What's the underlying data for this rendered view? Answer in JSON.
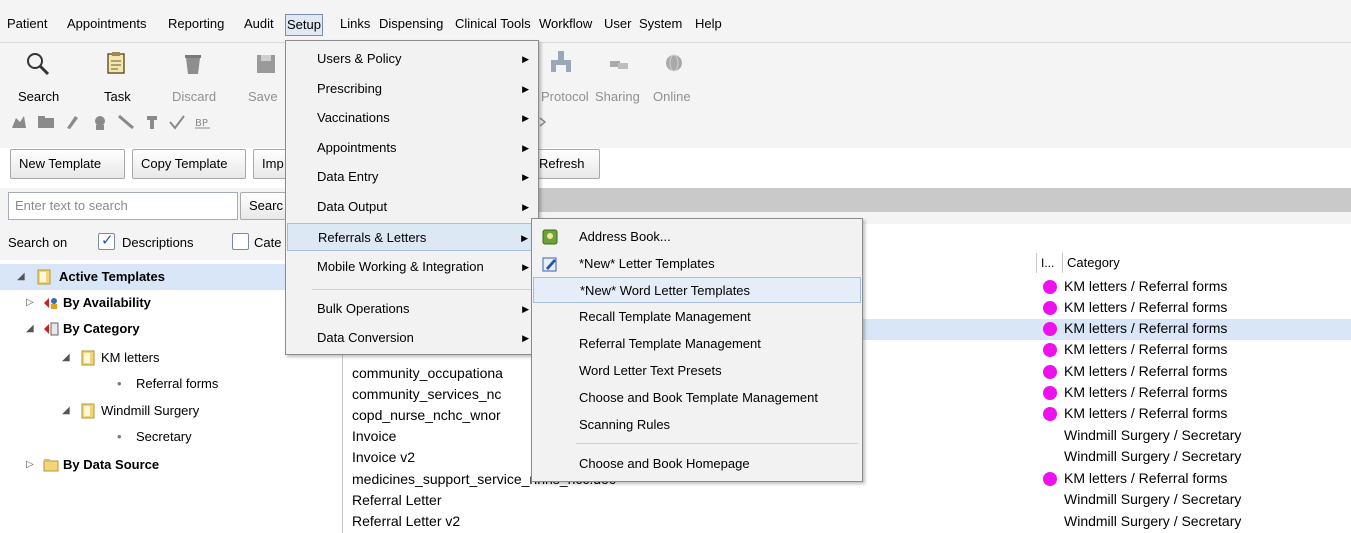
{
  "menubar": [
    "Patient",
    "Appointments",
    "Reporting",
    "Audit",
    "Setup",
    "Links",
    "Dispensing",
    "Clinical Tools",
    "Workflow",
    "User",
    "System",
    "Help"
  ],
  "toolbar": {
    "search": "Search",
    "task": "Task",
    "discard": "Discard",
    "save": "Save",
    "protocol": "Protocol",
    "sharing": "Sharing",
    "online": "Online"
  },
  "buttons": {
    "new_template": "New Template",
    "copy_template": "Copy Template",
    "import": "Imp",
    "refresh": "Refresh"
  },
  "search": {
    "placeholder": "Enter text to search",
    "button": "Searc",
    "search_on": "Search on",
    "descriptions": "Descriptions",
    "categories": "Cate"
  },
  "tree": {
    "active_templates": "Active Templates",
    "by_availability": "By Availability",
    "by_category": "By Category",
    "km_letters": "KM letters",
    "referral_forms": "Referral forms",
    "windmill_surgery": "Windmill Surgery",
    "secretary": "Secretary",
    "by_data_source": "By Data Source"
  },
  "table": {
    "col_i": "I...",
    "col_category": "Category",
    "names": [
      "community_occupationa",
      "community_services_nc",
      "copd_nurse_nchc_wnor",
      "Invoice",
      "Invoice v2",
      "medicines_support_service_nhns_ncc.doc",
      "Referral Letter",
      "Referral Letter v2"
    ],
    "categories": [
      "KM letters / Referral forms",
      "KM letters / Referral forms",
      "KM letters / Referral forms",
      "KM letters / Referral forms",
      "KM letters / Referral forms",
      "KM letters / Referral forms",
      "KM letters / Referral forms",
      "Windmill Surgery / Secretary",
      "Windmill Surgery / Secretary",
      "KM letters / Referral forms",
      "Windmill Surgery / Secretary",
      "Windmill Surgery / Secretary"
    ]
  },
  "setup_menu": {
    "items": [
      "Users & Policy",
      "Prescribing",
      "Vaccinations",
      "Appointments",
      "Data Entry",
      "Data Output",
      "Referrals & Letters",
      "Mobile Working & Integration",
      "Bulk Operations",
      "Data Conversion"
    ]
  },
  "submenu": {
    "items": [
      "Address Book...",
      "*New* Letter Templates",
      "*New* Word Letter Templates",
      "Recall Template Management",
      "Referral Template Management",
      "Word Letter Text Presets",
      "Choose and Book Template Management",
      "Scanning Rules",
      "Choose and Book Homepage"
    ]
  },
  "colors": {
    "pink_dot": "#ee11ee",
    "selection": "#d9e6f7",
    "menu_hover": "#dde8f5"
  }
}
